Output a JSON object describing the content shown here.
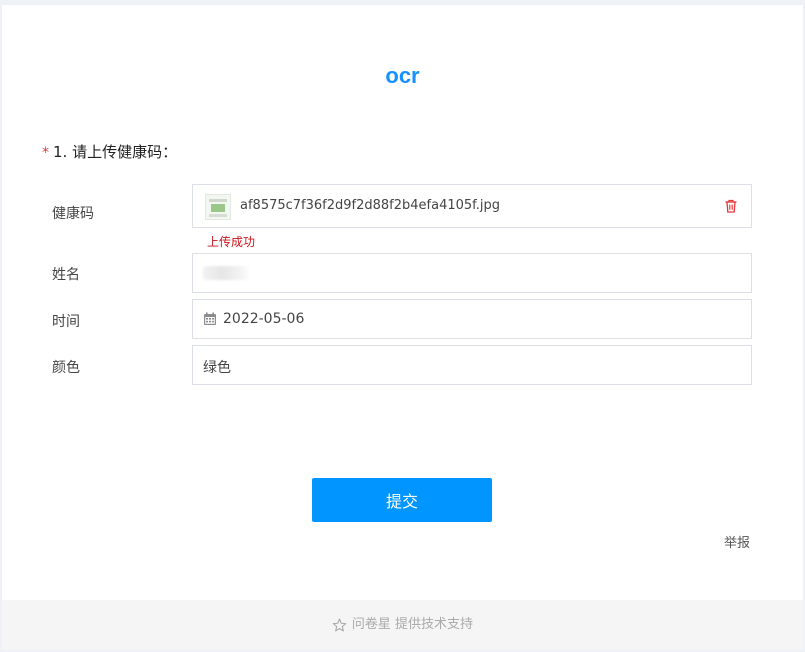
{
  "form": {
    "title": "ocr",
    "question": {
      "required_mark": "*",
      "text": "1. 请上传健康码："
    },
    "fields": {
      "health_code": {
        "label": "健康码",
        "file_name": "af8575c7f36f2d9f2d88f2b4efa4105f.jpg",
        "status": "上传成功"
      },
      "name": {
        "label": "姓名"
      },
      "time": {
        "label": "时间",
        "value": "2022-05-06"
      },
      "color": {
        "label": "颜色",
        "value": "绿色"
      }
    },
    "submit_label": "提交",
    "report_label": "举报"
  },
  "footer": {
    "text": "问卷星 提供技术支持"
  },
  "colors": {
    "accent": "#1890ff",
    "button": "#0095ff",
    "required": "#e4393c",
    "success_text": "#c8161d",
    "trash_icon": "#e4393c"
  },
  "icons": {
    "file_thumbnail": "image-thumbnail-icon",
    "delete": "trash-icon",
    "calendar": "calendar-icon",
    "footer": "star-icon"
  }
}
